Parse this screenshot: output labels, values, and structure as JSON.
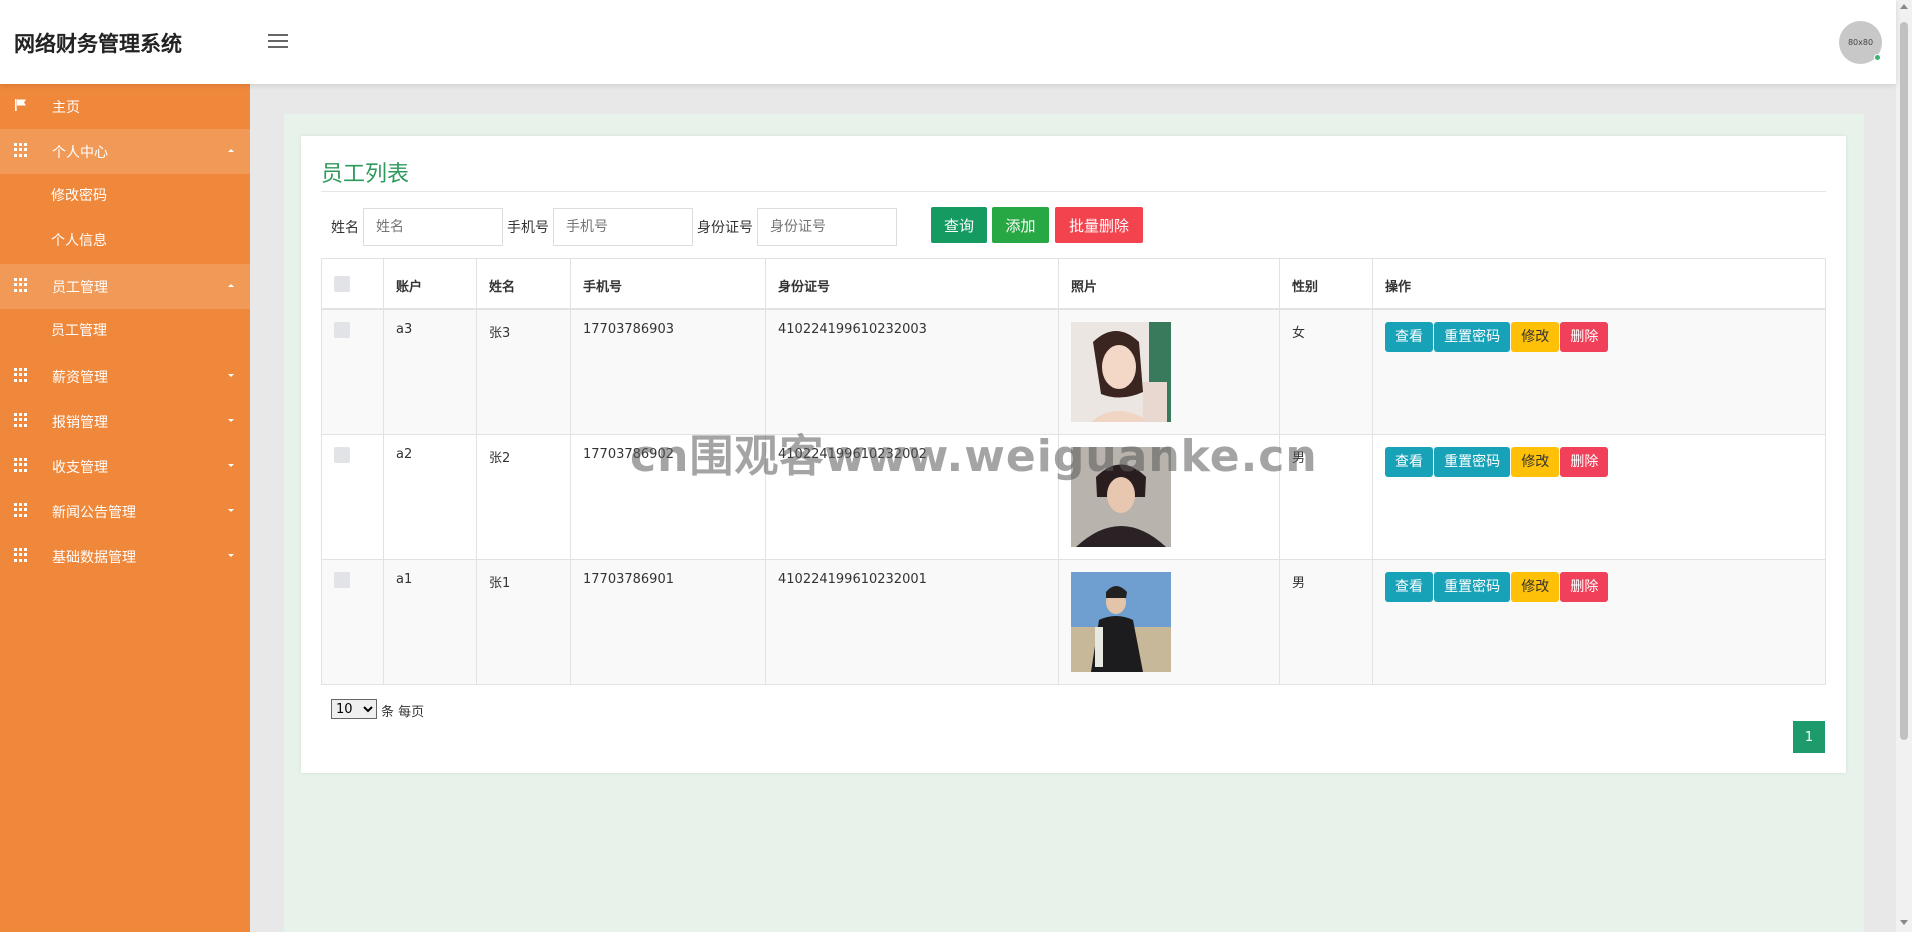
{
  "header": {
    "title": "网络财务管理系统",
    "avatar_text": "80x80"
  },
  "sidebar": {
    "items": [
      {
        "label": "主页",
        "icon": "flag-icon"
      },
      {
        "label": "个人中心",
        "icon": "grid-icon",
        "expanded": true,
        "children": [
          "修改密码",
          "个人信息"
        ]
      },
      {
        "label": "员工管理",
        "icon": "grid-icon",
        "expanded": true,
        "children": [
          "员工管理"
        ]
      },
      {
        "label": "薪资管理",
        "icon": "grid-icon",
        "expanded": false
      },
      {
        "label": "报销管理",
        "icon": "grid-icon",
        "expanded": false
      },
      {
        "label": "收支管理",
        "icon": "grid-icon",
        "expanded": false
      },
      {
        "label": "新闻公告管理",
        "icon": "grid-icon",
        "expanded": false
      },
      {
        "label": "基础数据管理",
        "icon": "grid-icon",
        "expanded": false
      }
    ]
  },
  "main": {
    "title": "员工列表",
    "search": {
      "name_label": "姓名",
      "name_placeholder": "姓名",
      "phone_label": "手机号",
      "phone_placeholder": "手机号",
      "idcard_label": "身份证号",
      "idcard_placeholder": "身份证号"
    },
    "buttons": {
      "query": "查询",
      "add": "添加",
      "batch_delete": "批量删除"
    },
    "table": {
      "columns": [
        "账户",
        "姓名",
        "手机号",
        "身份证号",
        "照片",
        "性别",
        "操作"
      ],
      "rows": [
        {
          "account": "a3",
          "name": "张3",
          "phone": "17703786903",
          "idcard": "410224199610232003",
          "gender": "女",
          "photo": "woman-portrait"
        },
        {
          "account": "a2",
          "name": "张2",
          "phone": "17703786902",
          "idcard": "410224199610232002",
          "gender": "男",
          "photo": "man-portrait"
        },
        {
          "account": "a1",
          "name": "张1",
          "phone": "17703786901",
          "idcard": "410224199610232001",
          "gender": "男",
          "photo": "man-outdoor"
        }
      ],
      "actions": {
        "view": "查看",
        "reset": "重置密码",
        "edit": "修改",
        "delete": "删除"
      }
    },
    "pagination": {
      "per_page": "10",
      "per_page_text": "条 每页",
      "current_page": "1"
    }
  },
  "watermark": "cn围观客www.weiguanke.cn",
  "colors": {
    "sidebar": "#f0883c",
    "accent": "#2e9a5c",
    "view": "#17a2b8",
    "edit": "#ffc107",
    "delete": "#f0405a"
  }
}
